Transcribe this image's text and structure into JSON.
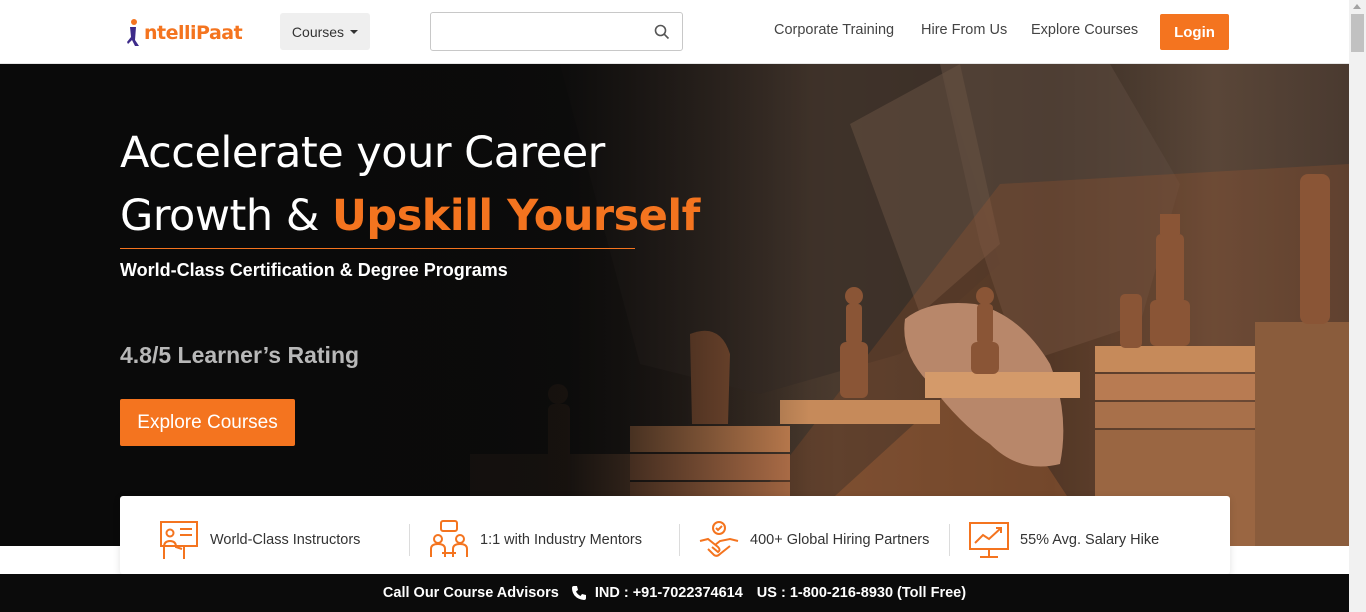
{
  "header": {
    "logo_text": "ntelliPaat",
    "courses_label": "Courses",
    "search_placeholder": "",
    "nav": [
      "Corporate Training",
      "Hire From Us",
      "Explore Courses"
    ],
    "login_label": "Login"
  },
  "hero": {
    "title_line1": "Accelerate your Career",
    "title_line2_plain": "Growth & ",
    "title_line2_accent": "Upskill Yourself",
    "subtitle": "World-Class Certification & Degree Programs",
    "rating": "4.8/5 Learner’s Rating",
    "cta_label": "Explore Courses"
  },
  "features": [
    {
      "icon": "instructor-icon",
      "label": "World-Class Instructors"
    },
    {
      "icon": "mentor-icon",
      "label": "1:1 with Industry Mentors"
    },
    {
      "icon": "handshake-icon",
      "label": "400+ Global Hiring Partners"
    },
    {
      "icon": "salary-chart-icon",
      "label": "55% Avg. Salary Hike"
    }
  ],
  "footer": {
    "call_label": "Call Our Course Advisors",
    "ind": "IND : +91-7022374614",
    "us": "US : 1-800-216-8930 (Toll Free)"
  },
  "colors": {
    "accent": "#f4741f",
    "dark": "#0b0b0b"
  }
}
